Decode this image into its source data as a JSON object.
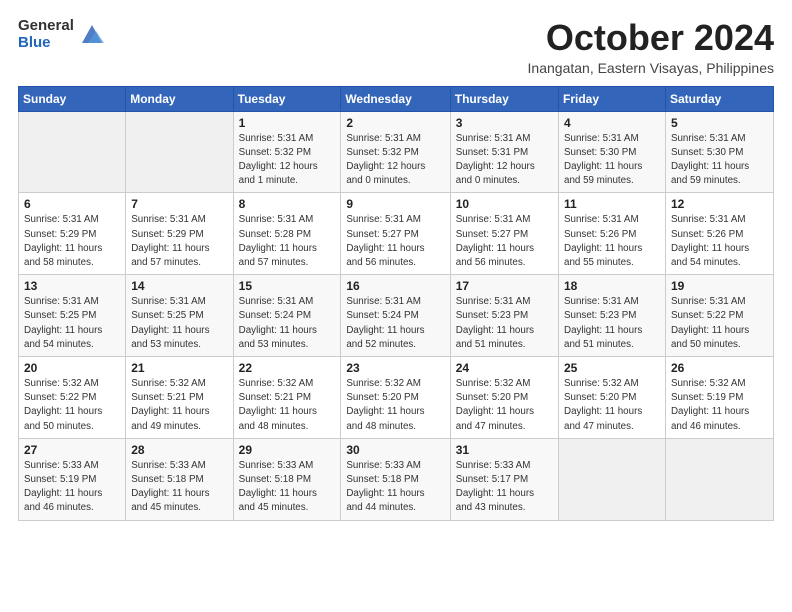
{
  "logo": {
    "general": "General",
    "blue": "Blue"
  },
  "header": {
    "month": "October 2024",
    "location": "Inangatan, Eastern Visayas, Philippines"
  },
  "weekdays": [
    "Sunday",
    "Monday",
    "Tuesday",
    "Wednesday",
    "Thursday",
    "Friday",
    "Saturday"
  ],
  "weeks": [
    [
      {
        "day": "",
        "info": ""
      },
      {
        "day": "",
        "info": ""
      },
      {
        "day": "1",
        "info": "Sunrise: 5:31 AM\nSunset: 5:32 PM\nDaylight: 12 hours\nand 1 minute."
      },
      {
        "day": "2",
        "info": "Sunrise: 5:31 AM\nSunset: 5:32 PM\nDaylight: 12 hours\nand 0 minutes."
      },
      {
        "day": "3",
        "info": "Sunrise: 5:31 AM\nSunset: 5:31 PM\nDaylight: 12 hours\nand 0 minutes."
      },
      {
        "day": "4",
        "info": "Sunrise: 5:31 AM\nSunset: 5:30 PM\nDaylight: 11 hours\nand 59 minutes."
      },
      {
        "day": "5",
        "info": "Sunrise: 5:31 AM\nSunset: 5:30 PM\nDaylight: 11 hours\nand 59 minutes."
      }
    ],
    [
      {
        "day": "6",
        "info": "Sunrise: 5:31 AM\nSunset: 5:29 PM\nDaylight: 11 hours\nand 58 minutes."
      },
      {
        "day": "7",
        "info": "Sunrise: 5:31 AM\nSunset: 5:29 PM\nDaylight: 11 hours\nand 57 minutes."
      },
      {
        "day": "8",
        "info": "Sunrise: 5:31 AM\nSunset: 5:28 PM\nDaylight: 11 hours\nand 57 minutes."
      },
      {
        "day": "9",
        "info": "Sunrise: 5:31 AM\nSunset: 5:27 PM\nDaylight: 11 hours\nand 56 minutes."
      },
      {
        "day": "10",
        "info": "Sunrise: 5:31 AM\nSunset: 5:27 PM\nDaylight: 11 hours\nand 56 minutes."
      },
      {
        "day": "11",
        "info": "Sunrise: 5:31 AM\nSunset: 5:26 PM\nDaylight: 11 hours\nand 55 minutes."
      },
      {
        "day": "12",
        "info": "Sunrise: 5:31 AM\nSunset: 5:26 PM\nDaylight: 11 hours\nand 54 minutes."
      }
    ],
    [
      {
        "day": "13",
        "info": "Sunrise: 5:31 AM\nSunset: 5:25 PM\nDaylight: 11 hours\nand 54 minutes."
      },
      {
        "day": "14",
        "info": "Sunrise: 5:31 AM\nSunset: 5:25 PM\nDaylight: 11 hours\nand 53 minutes."
      },
      {
        "day": "15",
        "info": "Sunrise: 5:31 AM\nSunset: 5:24 PM\nDaylight: 11 hours\nand 53 minutes."
      },
      {
        "day": "16",
        "info": "Sunrise: 5:31 AM\nSunset: 5:24 PM\nDaylight: 11 hours\nand 52 minutes."
      },
      {
        "day": "17",
        "info": "Sunrise: 5:31 AM\nSunset: 5:23 PM\nDaylight: 11 hours\nand 51 minutes."
      },
      {
        "day": "18",
        "info": "Sunrise: 5:31 AM\nSunset: 5:23 PM\nDaylight: 11 hours\nand 51 minutes."
      },
      {
        "day": "19",
        "info": "Sunrise: 5:31 AM\nSunset: 5:22 PM\nDaylight: 11 hours\nand 50 minutes."
      }
    ],
    [
      {
        "day": "20",
        "info": "Sunrise: 5:32 AM\nSunset: 5:22 PM\nDaylight: 11 hours\nand 50 minutes."
      },
      {
        "day": "21",
        "info": "Sunrise: 5:32 AM\nSunset: 5:21 PM\nDaylight: 11 hours\nand 49 minutes."
      },
      {
        "day": "22",
        "info": "Sunrise: 5:32 AM\nSunset: 5:21 PM\nDaylight: 11 hours\nand 48 minutes."
      },
      {
        "day": "23",
        "info": "Sunrise: 5:32 AM\nSunset: 5:20 PM\nDaylight: 11 hours\nand 48 minutes."
      },
      {
        "day": "24",
        "info": "Sunrise: 5:32 AM\nSunset: 5:20 PM\nDaylight: 11 hours\nand 47 minutes."
      },
      {
        "day": "25",
        "info": "Sunrise: 5:32 AM\nSunset: 5:20 PM\nDaylight: 11 hours\nand 47 minutes."
      },
      {
        "day": "26",
        "info": "Sunrise: 5:32 AM\nSunset: 5:19 PM\nDaylight: 11 hours\nand 46 minutes."
      }
    ],
    [
      {
        "day": "27",
        "info": "Sunrise: 5:33 AM\nSunset: 5:19 PM\nDaylight: 11 hours\nand 46 minutes."
      },
      {
        "day": "28",
        "info": "Sunrise: 5:33 AM\nSunset: 5:18 PM\nDaylight: 11 hours\nand 45 minutes."
      },
      {
        "day": "29",
        "info": "Sunrise: 5:33 AM\nSunset: 5:18 PM\nDaylight: 11 hours\nand 45 minutes."
      },
      {
        "day": "30",
        "info": "Sunrise: 5:33 AM\nSunset: 5:18 PM\nDaylight: 11 hours\nand 44 minutes."
      },
      {
        "day": "31",
        "info": "Sunrise: 5:33 AM\nSunset: 5:17 PM\nDaylight: 11 hours\nand 43 minutes."
      },
      {
        "day": "",
        "info": ""
      },
      {
        "day": "",
        "info": ""
      }
    ]
  ]
}
